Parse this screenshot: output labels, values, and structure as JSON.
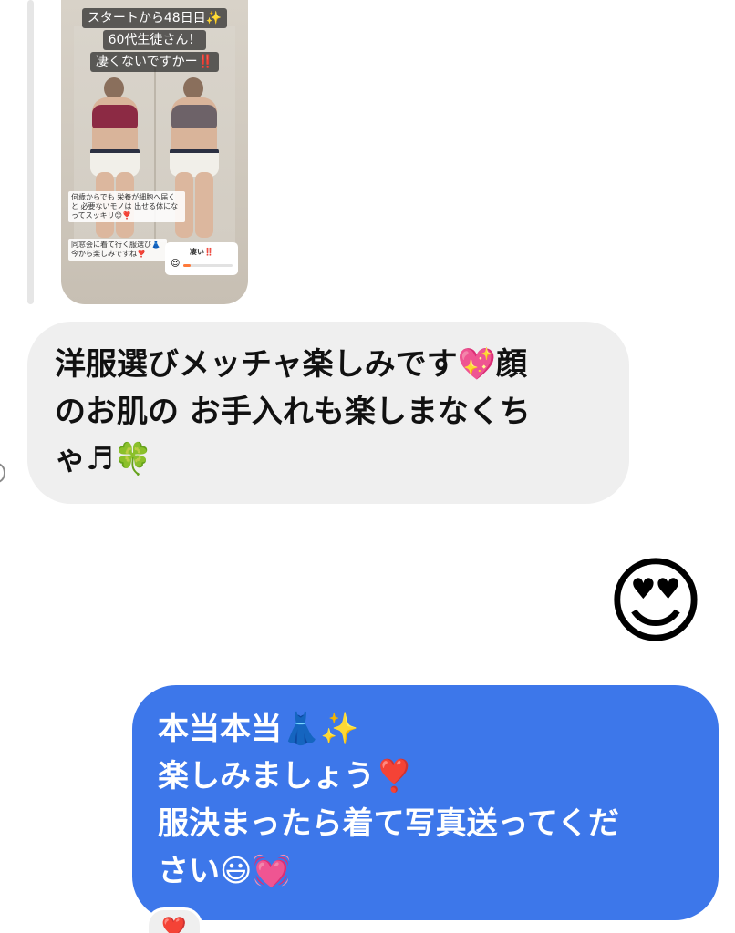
{
  "shared_story": {
    "caption_lines": [
      "スタートから48日目✨",
      "60代生徒さん！",
      "凄くないですかー‼️"
    ],
    "sticker_text_1": "何歳からでも 栄養が細胞へ届くと 必要ないモノは 出せる体になってスッキリ😊❣️",
    "sticker_text_2": "同窓会に着て行く服選び👗 今から楽しみですね❣️",
    "poll": {
      "label": "凄い‼️",
      "emoji": "😍",
      "level": 0.15,
      "fill_color": "#ff7a3a"
    }
  },
  "messages": {
    "incoming": {
      "lines": [
        "洋服選びメッチャ楽しみです💖顔",
        "のお肌の お手入れも楽しまなくち",
        "ゃ♬🍀"
      ],
      "bubble_color": "#efefef"
    },
    "big_emoji": "😍",
    "outgoing": {
      "lines": [
        "本当本当👗✨",
        "楽しみましょう❣️",
        "服決まったら着て写真送ってくだ",
        "さい😃💓"
      ],
      "bubble_color": "#3d77ea"
    },
    "reaction": "❤️"
  }
}
